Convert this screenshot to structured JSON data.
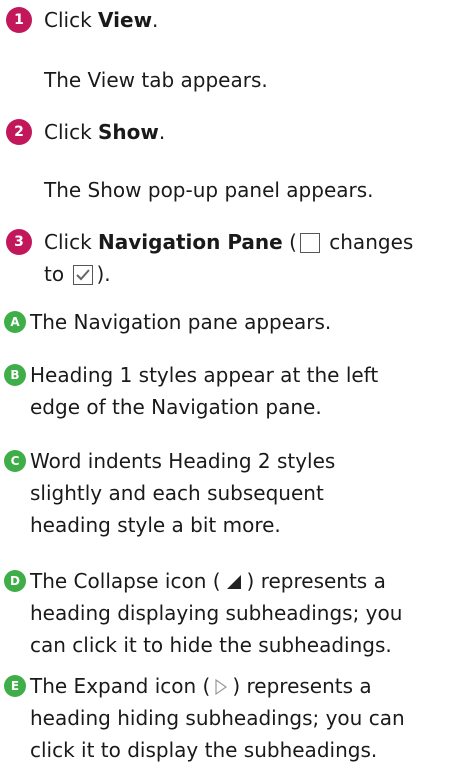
{
  "steps": [
    {
      "number": "1",
      "prefix": "Click ",
      "bold": "View",
      "suffix": ".",
      "result": "The View tab appears."
    },
    {
      "number": "2",
      "prefix": "Click ",
      "bold": "Show",
      "suffix": ".",
      "result": "The Show pop-up panel appears."
    },
    {
      "number": "3",
      "prefix": "Click ",
      "bold": "Navigation Pane",
      "middle1": " (",
      "middle2": " changes",
      "line2a": "to ",
      "line2b": ")."
    }
  ],
  "callouts": [
    {
      "letter": "A",
      "text": "The Navigation pane appears."
    },
    {
      "letter": "B",
      "line1": "Heading 1 styles appear at the left",
      "line2": "edge of the Navigation pane."
    },
    {
      "letter": "C",
      "line1": "Word indents Heading 2 styles",
      "line2": "slightly and each subsequent",
      "line3": "heading style a bit more."
    },
    {
      "letter": "D",
      "line1a": "The Collapse icon (",
      "line1b": ") represents a",
      "line2": "heading displaying subheadings; you",
      "line3": "can click it to hide the subheadings."
    },
    {
      "letter": "E",
      "line1a": "The Expand icon (",
      "line1b": ") represents a",
      "line2": "heading hiding subheadings; you can",
      "line3": "click it to display the subheadings."
    }
  ],
  "icons": {
    "step_badge_color": "#c2185b",
    "callout_badge_color": "#3fae49",
    "unchecked": "checkbox-unchecked-icon",
    "checked": "checkbox-checked-icon",
    "collapse": "collapse-triangle-icon",
    "expand": "expand-triangle-icon"
  }
}
